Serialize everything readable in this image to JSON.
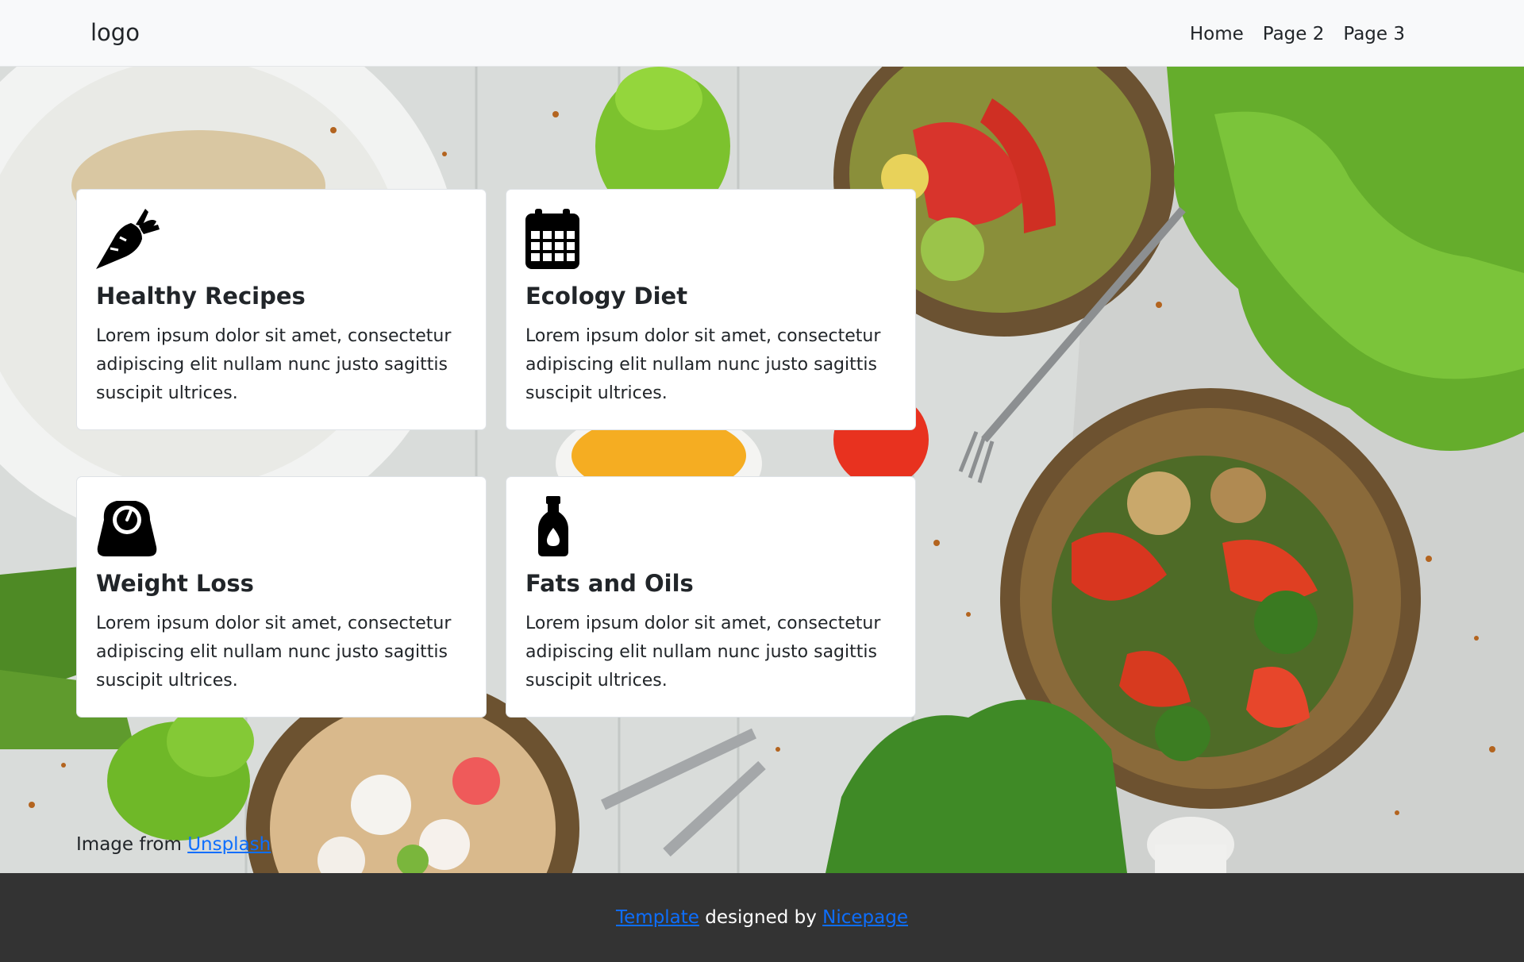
{
  "header": {
    "logo": "logo",
    "nav": [
      "Home",
      "Page 2",
      "Page 3"
    ]
  },
  "cards": [
    {
      "icon": "carrot-icon",
      "title": "Healthy Recipes",
      "text": "Lorem ipsum dolor sit amet, consectetur adipiscing elit nullam nunc justo sagittis suscipit ultrices."
    },
    {
      "icon": "calendar-icon",
      "title": "Ecology Diet",
      "text": "Lorem ipsum dolor sit amet, consectetur adipiscing elit nullam nunc justo sagittis suscipit ultrices."
    },
    {
      "icon": "scale-icon",
      "title": "Weight Loss",
      "text": "Lorem ipsum dolor sit amet, consectetur adipiscing elit nullam nunc justo sagittis suscipit ultrices."
    },
    {
      "icon": "bottle-icon",
      "title": "Fats and Oils",
      "text": "Lorem ipsum dolor sit amet, consectetur adipiscing elit nullam nunc justo sagittis suscipit ultrices."
    }
  ],
  "credit": {
    "prefix": "Image from ",
    "link": "Unsplash"
  },
  "footer": {
    "link1": "Template",
    "middle": " designed by ",
    "link2": "Nicepage"
  },
  "colors": {
    "header_bg": "#f8f9fa",
    "footer_bg": "#333333",
    "link": "#0d6efd"
  }
}
